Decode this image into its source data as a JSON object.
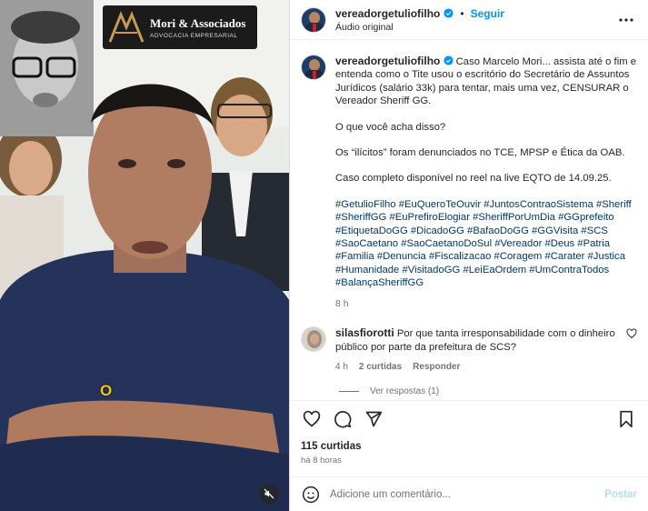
{
  "media": {
    "logo_title": "Mori & Associados",
    "logo_subtitle": "ADVOCACIA EMPRESARIAL",
    "caption_overlay": "O"
  },
  "header": {
    "username": "vereadorgetuliofilho",
    "follow_label": "Seguir",
    "audio_label": "Áudio original"
  },
  "post": {
    "username": "vereadorgetuliofilho",
    "text_1": "Caso Marcelo Mori... assista até o fim e entenda como o Tite usou o escritório do Secretário de Assuntos Jurídicos (salário 33k) para tentar, mais uma vez, CENSURAR o Vereador Sheriff GG.",
    "text_2": "O que você acha disso?",
    "text_3": "Os “ilícitos” foram denunciados no TCE, MPSP e Ética da OAB.",
    "text_4": "Caso completo disponível no reel na live EQTO de 14.09.25.",
    "hashtags": "#GetulioFilho #EuQueroTeOuvir #JuntosContraoSistema #Sheriff #SheriffGG #EuPrefiroElogiar #SheriffPorUmDia #GGprefeito #EtiquetaDoGG #DicadoGG #BafaoDoGG #GGVisita #SCS #SaoCaetano #SaoCaetanoDoSul #Vereador #Deus #Patria #Familia #Denuncia #Fiscalizacao #Coragem #Carater #Justica #Humanidade #VisitadoGG #LeiEaOrdem #UmContraTodos #BalançaSheriffGG",
    "time": "8 h"
  },
  "comment": {
    "username": "silasfiorotti",
    "text": "Por que tanta irresponsabilidade com o dinheiro público por parte da prefeitura de SCS?",
    "time": "4 h",
    "likes": "2 curtidas",
    "reply_label": "Responder",
    "view_replies": "Ver respostas (1)"
  },
  "actions": {
    "likes_count": "115 curtidas",
    "posted_ago": "há 8 horas"
  },
  "comment_input": {
    "placeholder": "Adicione um comentário...",
    "post_label": "Postar"
  },
  "colors": {
    "accent": "#0095f6",
    "hashtag": "#00376b",
    "caption_yellow": "#f2c414"
  }
}
